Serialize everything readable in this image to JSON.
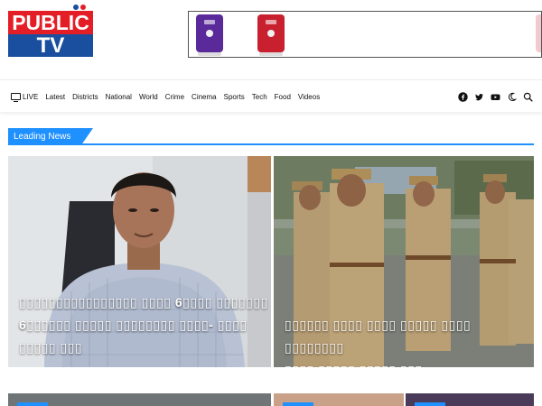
{
  "brand": {
    "logo_top": "PUBLIC",
    "logo_bottom": "TV",
    "red": "#e41e26",
    "blue": "#1a4fa0",
    "accent": "#1e90ff"
  },
  "nav": {
    "items": [
      "LIVE",
      "Latest",
      "Districts",
      "National",
      "World",
      "Crime",
      "Cinema",
      "Sports",
      "Tech",
      "Food",
      "Videos"
    ],
    "icons": [
      "facebook-icon",
      "twitter-icon",
      "youtube-icon",
      "dark-mode-moon-icon",
      "search-icon"
    ]
  },
  "section": {
    "title": "Leading News"
  },
  "cards": [
    {
      "caption_lines": [
        "▯▯▯▯▯▯▯▯▯▯▯▯▯▯▯▯ ▯▯▯▯ 6▯▯▯▯ ▯▯▯▯▯▯▯",
        "6▯▯▯▯▯▯ ▯▯▯▯▯ ▯▯▯▯▯▯▯▯ ▯▯▯▯- ▯▯▯▯",
        "▯▯▯▯▯ ▯▯▯"
      ]
    },
    {
      "caption_lines": [
        "▯▯▯▯▯▯ ▯▯▯▯ ▯▯▯▯ ▯▯▯▯▯ ▯▯▯▯ ▯▯▯▯▯▯▯▯",
        "▯▯▯▯ ▯▯▯▯▯ ▯▯▯▯▯ ▯▯▯"
      ]
    }
  ]
}
